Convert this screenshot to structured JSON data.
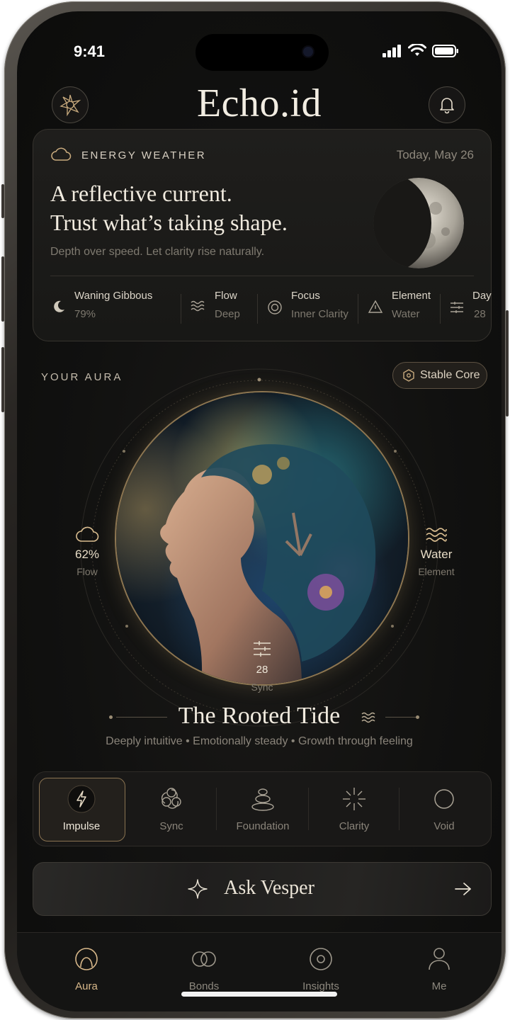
{
  "status_bar": {
    "time": "9:41"
  },
  "header": {
    "title": "Echo.id",
    "left_icon": "sun-emblem-icon",
    "right_icon": "bell-icon"
  },
  "energy_weather": {
    "label": "ENERGY WEATHER",
    "date": "Today, May 26",
    "headline_line1": "A reflective current.",
    "headline_line2": "Trust what’s taking shape.",
    "subtext": "Depth over speed. Let clarity rise naturally.",
    "stats": [
      {
        "label": "Waning Gibbous",
        "value": "79%",
        "icon": "moon-icon"
      },
      {
        "label": "Flow",
        "value": "Deep",
        "icon": "waves-icon"
      },
      {
        "label": "Focus",
        "value": "Inner Clarity",
        "icon": "target-icon"
      },
      {
        "label": "Element",
        "value": "Water",
        "icon": "triangle-icon"
      },
      {
        "label": "Day",
        "value": "28",
        "icon": "lines-icon"
      }
    ]
  },
  "aura": {
    "label": "YOUR AURA",
    "badge": "Stable Core",
    "left_stat": {
      "value": "62%",
      "label": "Flow"
    },
    "right_stat": {
      "value": "Water",
      "label": "Element"
    },
    "bottom_stat": {
      "value": "28",
      "label": "Sync"
    },
    "title": "The Rooted Tide",
    "traits": "Deeply intuitive • Emotionally steady • Growth through feeling"
  },
  "modes": [
    {
      "label": "Impulse",
      "icon": "lightning-icon",
      "active": true
    },
    {
      "label": "Sync",
      "icon": "sync-icon",
      "active": false
    },
    {
      "label": "Foundation",
      "icon": "stones-icon",
      "active": false
    },
    {
      "label": "Clarity",
      "icon": "sparkle-burst-icon",
      "active": false
    },
    {
      "label": "Void",
      "icon": "circle-icon",
      "active": false
    }
  ],
  "ask": {
    "label": "Ask Vesper"
  },
  "tabs": [
    {
      "label": "Aura",
      "icon": "aura-icon",
      "active": true
    },
    {
      "label": "Bonds",
      "icon": "bonds-icon",
      "active": false
    },
    {
      "label": "Insights",
      "icon": "insights-icon",
      "active": false
    },
    {
      "label": "Me",
      "icon": "person-icon",
      "active": false
    }
  ],
  "colors": {
    "accent_gold": "#d8b88a",
    "background": "#111110",
    "text": "#e8e2d6"
  }
}
